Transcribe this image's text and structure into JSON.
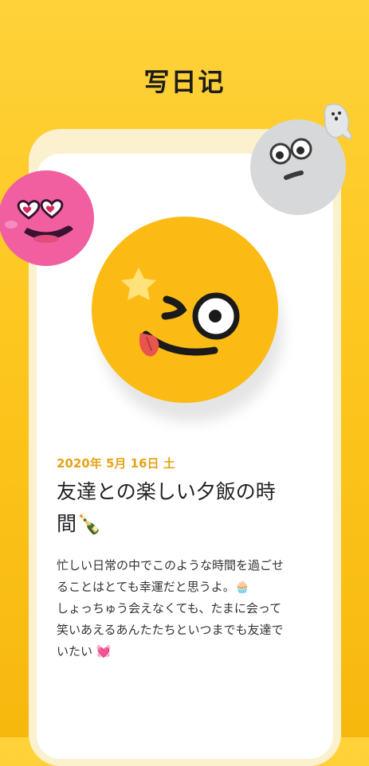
{
  "header": {
    "title": "写日记"
  },
  "entry": {
    "date": "2020年 5月 16日 土",
    "title_line1": "友達との楽しい夕飯の時",
    "title_line2": "間🍾",
    "body_lines": [
      "忙しい日常の中でこのような時間を過ごせ",
      "ることはとても幸運だと思うよ。🧁",
      "しょっちゅう会えなくても、たまに会って",
      "笑いあえるあんたたちといつまでも友達で",
      "いたい 💓"
    ]
  },
  "stickers": {
    "main_face": "winking-tongue-face-icon",
    "pink_face": "heart-eyes-face-icon",
    "grey_face": "surprised-eyes-face-icon",
    "ghost": "ghost-icon"
  },
  "colors": {
    "background": "#fdc71f",
    "date_accent": "#e6a317",
    "pink_face": "#f25fa0",
    "grey_face": "#d7d8da",
    "yellow_face": "#fbbb14"
  }
}
